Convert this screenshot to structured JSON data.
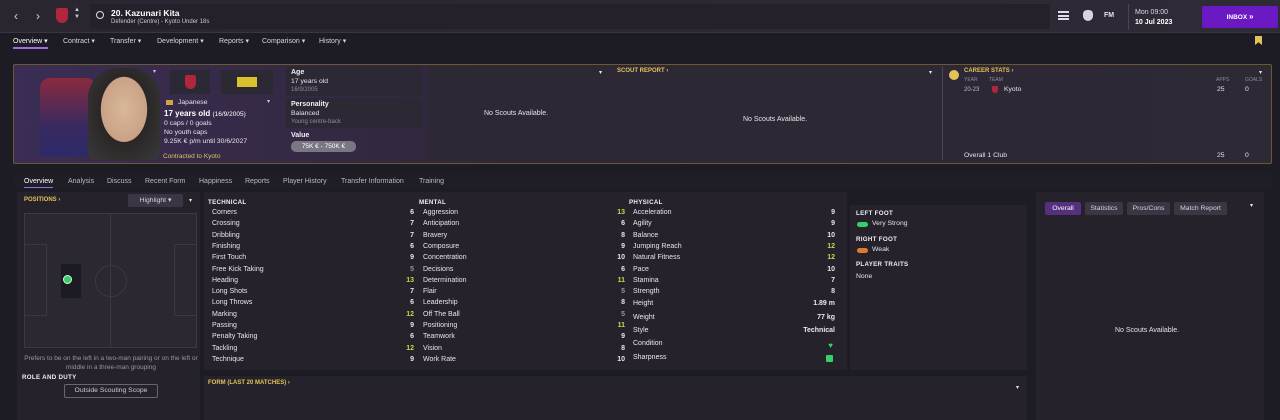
{
  "header": {
    "player_title": "20. Kazunari Kita",
    "player_subtitle": "Defender (Centre) - Kyoto Under 18s",
    "date_day": "Mon 09:00",
    "date": "10 Jul 2023",
    "inbox_label": "INBOX",
    "fm_label": "FM"
  },
  "tabs": [
    "Overview",
    "Contract",
    "Transfer",
    "Development",
    "Reports",
    "Comparison",
    "History"
  ],
  "profile": {
    "nationality": "Japanese",
    "age_main": "17 years old",
    "dob_paren": "(16/9/2005)",
    "caps": "0 caps / 0 goals",
    "youth_caps": "No youth caps",
    "wage": "9.25K € p/m until 30/6/2027",
    "contracted": "Contracted to Kyoto",
    "age_label": "Age",
    "age_value": "17 years old",
    "dob": "16/9/2005",
    "personality_label": "Personality",
    "personality_value": "Balanced",
    "role_desc": "Young centre-back",
    "value_label": "Value",
    "value_range": "75K € - 750K €"
  },
  "scouts_text": "No Scouts Available.",
  "scout_report_label": "SCOUT REPORT",
  "career": {
    "label": "CAREER STATS",
    "col_year": "YEAR",
    "col_team": "TEAM",
    "col_apps": "APPS",
    "col_goals": "GOALS",
    "row_year": "20-23",
    "row_team": "Kyoto",
    "row_apps": "25",
    "row_goals": "0",
    "total_label": "Overall 1 Club",
    "total_apps": "25",
    "total_goals": "0"
  },
  "subtabs": [
    "Overview",
    "Analysis",
    "Discuss",
    "Recent Form",
    "Happiness",
    "Reports",
    "Player History",
    "Transfer Information",
    "Training"
  ],
  "positions": {
    "label": "POSITIONS",
    "highlight": "Highlight",
    "note": "Prefers to be on the left in a two-man pairing or on the left or middle in a three-man grouping",
    "role_duty": "ROLE AND DUTY",
    "scope_button": "Outside Scouting Scope"
  },
  "attributes": {
    "technical_label": "TECHNICAL",
    "mental_label": "MENTAL",
    "physical_label": "PHYSICAL",
    "technical": [
      {
        "name": "Corners",
        "value": "6"
      },
      {
        "name": "Crossing",
        "value": "7"
      },
      {
        "name": "Dribbling",
        "value": "7"
      },
      {
        "name": "Finishing",
        "value": "6"
      },
      {
        "name": "First Touch",
        "value": "9"
      },
      {
        "name": "Free Kick Taking",
        "value": "5"
      },
      {
        "name": "Heading",
        "value": "13"
      },
      {
        "name": "Long Shots",
        "value": "7"
      },
      {
        "name": "Long Throws",
        "value": "6"
      },
      {
        "name": "Marking",
        "value": "12"
      },
      {
        "name": "Passing",
        "value": "9"
      },
      {
        "name": "Penalty Taking",
        "value": "6"
      },
      {
        "name": "Tackling",
        "value": "12"
      },
      {
        "name": "Technique",
        "value": "9"
      }
    ],
    "mental": [
      {
        "name": "Aggression",
        "value": "13"
      },
      {
        "name": "Anticipation",
        "value": "6"
      },
      {
        "name": "Bravery",
        "value": "8"
      },
      {
        "name": "Composure",
        "value": "9"
      },
      {
        "name": "Concentration",
        "value": "10"
      },
      {
        "name": "Decisions",
        "value": "6"
      },
      {
        "name": "Determination",
        "value": "11"
      },
      {
        "name": "Flair",
        "value": "5"
      },
      {
        "name": "Leadership",
        "value": "8"
      },
      {
        "name": "Off The Ball",
        "value": "5"
      },
      {
        "name": "Positioning",
        "value": "11"
      },
      {
        "name": "Teamwork",
        "value": "9"
      },
      {
        "name": "Vision",
        "value": "8"
      },
      {
        "name": "Work Rate",
        "value": "10"
      }
    ],
    "physical": [
      {
        "name": "Acceleration",
        "value": "9"
      },
      {
        "name": "Agility",
        "value": "9"
      },
      {
        "name": "Balance",
        "value": "10"
      },
      {
        "name": "Jumping Reach",
        "value": "12"
      },
      {
        "name": "Natural Fitness",
        "value": "12"
      },
      {
        "name": "Pace",
        "value": "10"
      },
      {
        "name": "Stamina",
        "value": "7"
      },
      {
        "name": "Strength",
        "value": "8"
      }
    ],
    "height_label": "Height",
    "height_value": "1.89 m",
    "weight_label": "Weight",
    "weight_value": "77 kg",
    "style_label": "Style",
    "style_value": "Technical",
    "condition_label": "Condition",
    "sharpness_label": "Sharpness"
  },
  "feet": {
    "left_label": "LEFT FOOT",
    "left_value": "Very Strong",
    "right_label": "RIGHT FOOT",
    "right_value": "Weak",
    "traits_label": "PLAYER TRAITS",
    "traits_value": "None"
  },
  "form_label": "FORM (LAST 20 MATCHES)",
  "report_tabs": [
    "Overall",
    "Statistics",
    "Pros/Cons",
    "Match Report"
  ],
  "colors": {
    "accent": "#6a19c3",
    "gold": "#e1c35a",
    "green": "#35d06a"
  }
}
